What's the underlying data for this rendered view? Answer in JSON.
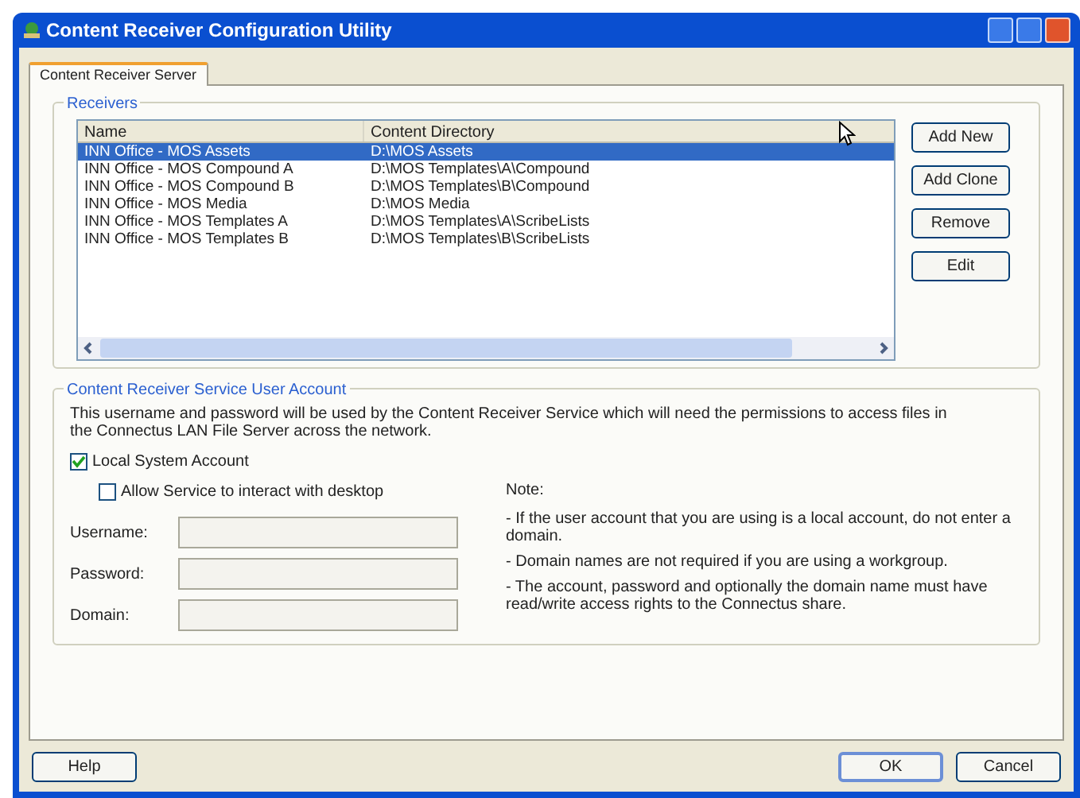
{
  "window": {
    "title": "Content Receiver Configuration Utility"
  },
  "tabs": [
    {
      "label": "Content Receiver Server",
      "selected": true
    }
  ],
  "receivers": {
    "title": "Receivers",
    "columns": [
      "Name",
      "Content Directory"
    ],
    "rows": [
      {
        "name": "INN Office - MOS Assets",
        "directory": "D:\\MOS Assets",
        "selected": true
      },
      {
        "name": "INN Office - MOS Compound A",
        "directory": "D:\\MOS Templates\\A\\Compound",
        "selected": false
      },
      {
        "name": "INN Office - MOS Compound B",
        "directory": "D:\\MOS Templates\\B\\Compound",
        "selected": false
      },
      {
        "name": "INN Office - MOS Media",
        "directory": "D:\\MOS Media",
        "selected": false
      },
      {
        "name": "INN Office - MOS Templates A",
        "directory": "D:\\MOS Templates\\A\\ScribeLists",
        "selected": false
      },
      {
        "name": "INN Office - MOS Templates B",
        "directory": "D:\\MOS Templates\\B\\ScribeLists",
        "selected": false
      }
    ],
    "buttons": [
      "Add New",
      "Add Clone",
      "Remove",
      "Edit"
    ]
  },
  "account": {
    "title": "Content Receiver Service User Account",
    "description": "This username and password will be used by the Content Receiver Service which will need the permissions to access files in the Connectus LAN File Server across the network.",
    "checkboxes": [
      {
        "label": "Local System Account",
        "checked": true
      },
      {
        "label": "Allow Service to interact with desktop",
        "checked": false
      }
    ],
    "fields": [
      {
        "label": "Username:"
      },
      {
        "label": "Password:"
      },
      {
        "label": "Domain:"
      }
    ],
    "note_title": "Note:",
    "notes": [
      "- If the user account that you are using is a local account, do not enter a domain.",
      "- Domain names are not required if you are using a workgroup.",
      "- The account, password and optionally the domain name must have read/write access rights to the Connectus share."
    ]
  },
  "footer": {
    "help": "Help",
    "ok": "OK",
    "cancel": "Cancel"
  }
}
